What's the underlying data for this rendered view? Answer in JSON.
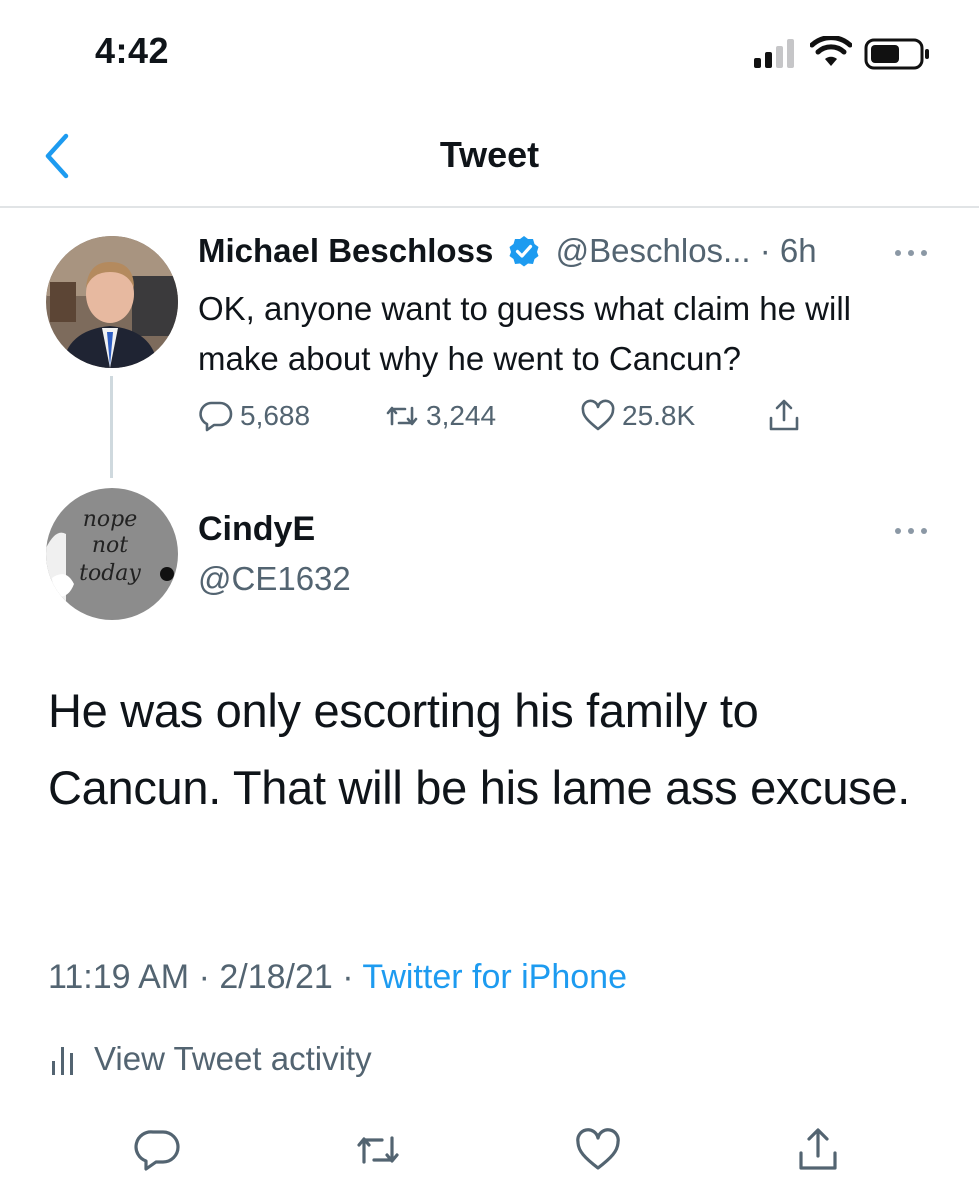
{
  "status_bar": {
    "time": "4:42"
  },
  "nav": {
    "title": "Tweet"
  },
  "parent_tweet": {
    "name": "Michael Beschloss",
    "handle": "@Beschlos...",
    "time": "· 6h",
    "text": "OK, anyone want to guess what claim he will make about why he went to Cancun?",
    "replies": "5,688",
    "retweets": "3,244",
    "likes": "25.8K"
  },
  "reply_tweet": {
    "name": "CindyE",
    "handle": "@CE1632",
    "avatar_text": [
      "nope",
      "not",
      "today"
    ],
    "text": "He was only escorting his family to Cancun. That will be his lame ass excuse.",
    "time": "11:19 AM",
    "date": "· 2/18/21 ·",
    "source": "Twitter for iPhone",
    "activity_label": "View Tweet activity"
  },
  "colors": {
    "accent": "#1d9bf0",
    "secondary_text": "#536471",
    "divider": "#e1e4e6"
  }
}
